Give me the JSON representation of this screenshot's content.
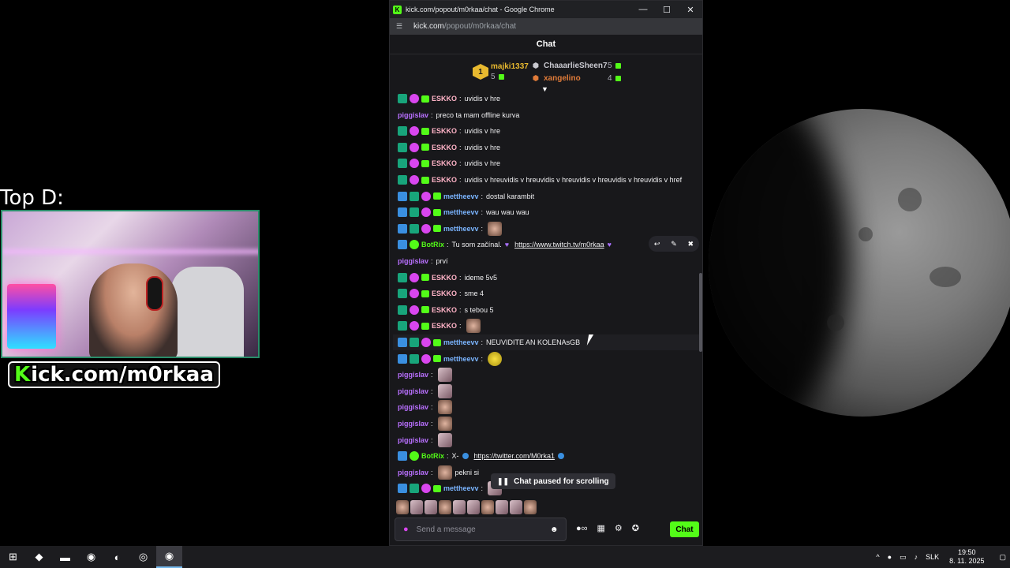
{
  "overlay": {
    "top_label": "Top D:",
    "kick_logo_k": "K",
    "kick_logo_rest": "ick.com/m0rkaa"
  },
  "browser": {
    "window_title": "kick.com/popout/m0rkaa/chat - Google Chrome",
    "url_host": "kick.com",
    "url_path": "/popout/m0rkaa/chat",
    "minimize": "—",
    "maximize": "☐",
    "close": "✕"
  },
  "chat": {
    "header": "Chat",
    "leaderboard": {
      "first_rank": "1",
      "first_name": "majki1337",
      "first_count": "5",
      "second_name": "ChaaarlieSheen7",
      "second_count": "5",
      "third_name": "xangelino",
      "third_count": "4"
    },
    "messages": [
      {
        "user": "ESKKO",
        "text": "uvidis v hre",
        "style": "eskko"
      },
      {
        "user": "piggislav",
        "text": "preco ta mam offline kurva",
        "style": "pig"
      },
      {
        "user": "ESKKO",
        "text": "uvidis v hre",
        "style": "eskko"
      },
      {
        "user": "ESKKO",
        "text": "uvidis v hre",
        "style": "eskko"
      },
      {
        "user": "ESKKO",
        "text": "uvidis v hre",
        "style": "eskko"
      },
      {
        "user": "ESKKO",
        "text": "uvidis v hreuvidis v hreuvidis v hreuvidis v hreuvidis v hreuvidis v href",
        "style": "eskko"
      },
      {
        "user": "mettheevv",
        "text": "dostal karambit",
        "style": "mett"
      },
      {
        "user": "mettheevv",
        "text": "wau wau wau",
        "style": "mett"
      },
      {
        "user": "mettheevv",
        "text": "",
        "style": "mett"
      },
      {
        "user": "BotRix",
        "text": "Tu som začínal.",
        "link": "https://www.twitch.tv/m0rkaa",
        "style": "bot"
      },
      {
        "user": "piggislav",
        "text": "prví",
        "style": "pig"
      },
      {
        "user": "ESKKO",
        "text": "ideme 5v5",
        "style": "eskko"
      },
      {
        "user": "ESKKO",
        "text": "sme 4",
        "style": "eskko"
      },
      {
        "user": "ESKKO",
        "text": "s tebou 5",
        "style": "eskko"
      },
      {
        "user": "ESKKO",
        "text": "",
        "style": "eskko"
      },
      {
        "user": "mettheevv",
        "text": "NEUVIDITE AN KOLENAsGB",
        "style": "mett"
      },
      {
        "user": "mettheevv",
        "text": "",
        "style": "mett"
      },
      {
        "user": "piggislav",
        "text": "",
        "style": "pig"
      },
      {
        "user": "piggislav",
        "text": "",
        "style": "pig"
      },
      {
        "user": "piggislav",
        "text": "",
        "style": "pig"
      },
      {
        "user": "piggislav",
        "text": "",
        "style": "pig"
      },
      {
        "user": "piggislav",
        "text": "",
        "style": "pig"
      },
      {
        "user": "BotRix",
        "text": "X-",
        "link": "https://twitter.com/M0rka1",
        "style": "bot"
      },
      {
        "user": "piggislav",
        "text": "pekni si",
        "style": "pig"
      },
      {
        "user": "mettheevv",
        "text": "",
        "style": "mett"
      }
    ],
    "paused_label": "Chat paused for scrolling",
    "input_placeholder": "Send a message",
    "send_label": "Chat"
  },
  "taskbar": {
    "language": "SLK",
    "time": "19:50",
    "date": "8. 11. 2025"
  },
  "colors": {
    "kick_green": "#53fc18",
    "chat_bg": "#18181b"
  }
}
